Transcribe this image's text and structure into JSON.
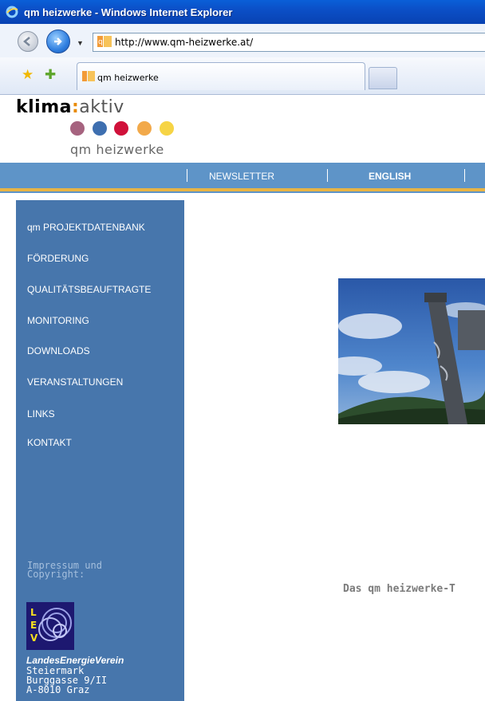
{
  "window": {
    "title": "qm heizwerke - Windows Internet Explorer"
  },
  "address_bar": {
    "url": "http://www.qm-heizwerke.at/"
  },
  "tab": {
    "label": "qm heizwerke"
  },
  "logo": {
    "part1": "klima",
    "colon": ":",
    "part2": "aktiv",
    "subtitle": "qm heizwerke",
    "dot_colors": [
      "#a6637f",
      "#3e6fb0",
      "#d0113a",
      "#f2a94a",
      "#f6d445"
    ]
  },
  "top_nav": {
    "items": [
      "NEWSLETTER",
      "ENGLISH"
    ]
  },
  "sidebar": {
    "items": [
      "qm PROJEKTDATENBANK",
      "FÖRDERUNG",
      "QUALITÄTSBEAUFTRAGTE",
      "MONITORING",
      "DOWNLOADS",
      "VERANSTALTUNGEN",
      "LINKS",
      "KONTAKT"
    ],
    "impressum": "Impressum und Copyright:",
    "org_name": "LandesEnergieVerein",
    "org_lines": [
      "Steiermark",
      "Burggasse 9/II",
      "A-8010 Graz"
    ]
  },
  "content": {
    "text": "Das qm heizwerke-T"
  },
  "colors": {
    "sidebar": "#4776ac",
    "topnav": "#5e94c8",
    "accent_stripe": "#e8b445"
  }
}
